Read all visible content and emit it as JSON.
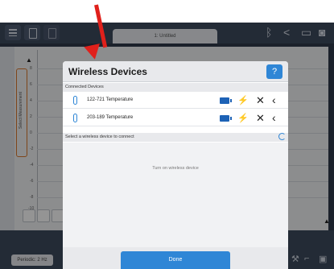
{
  "app": {
    "tab_title": "1: Untitled"
  },
  "graph": {
    "select_measurement": "Select Measurement",
    "y_ticks": [
      "8",
      "6",
      "4",
      "2",
      "0",
      "-2",
      "-4",
      "-6",
      "-8",
      "-10"
    ]
  },
  "bottom": {
    "rate": "Periodic: 2 Hz"
  },
  "modal": {
    "title": "Wireless Devices",
    "help_label": "?",
    "connected_label": "Connected Devices",
    "devices": [
      {
        "name": "122-721  Temperature"
      },
      {
        "name": "203-189  Temperature"
      }
    ],
    "select_label": "Select a wireless device to connect",
    "empty_message": "Turn on wireless device",
    "done_label": "Done"
  },
  "colors": {
    "accent": "#2f86d6",
    "arrow": "#e0201b",
    "highlight": "#d9782e"
  }
}
